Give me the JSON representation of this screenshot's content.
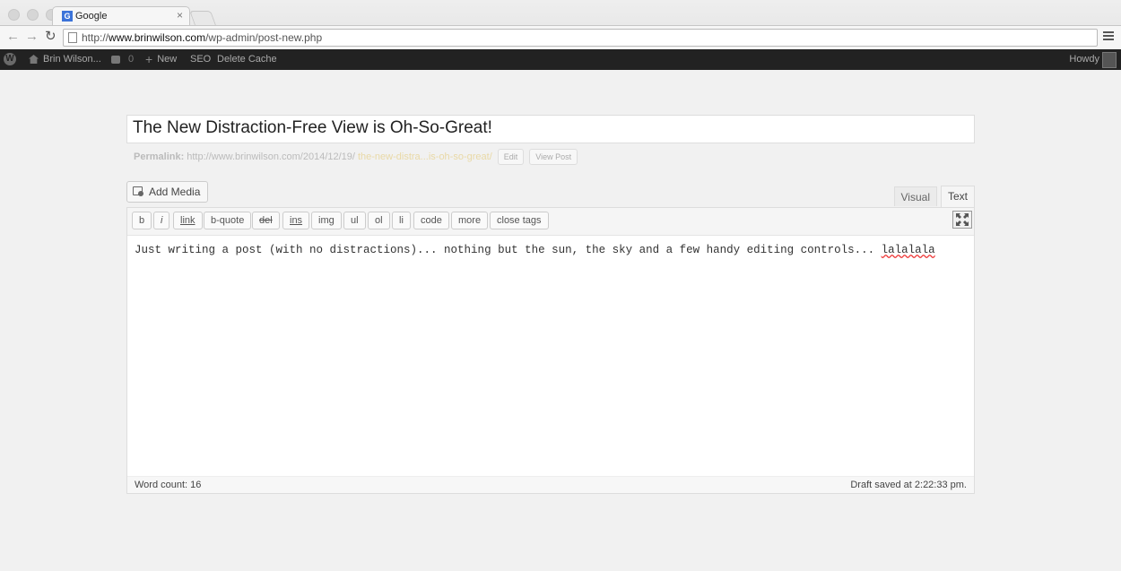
{
  "browser": {
    "tab_title": "Google",
    "tab_favicon": "G",
    "url_prefix": "http://",
    "url_domain": "www.brinwilson.com",
    "url_path": "/wp-admin/post-new.php"
  },
  "adminbar": {
    "site": "Brin Wilson...",
    "comments_count": "0",
    "new_label": "New",
    "seo_label": "SEO",
    "cache_label": "Delete Cache",
    "howdy": "Howdy"
  },
  "post": {
    "title": "The New Distraction-Free View is Oh-So-Great!",
    "permalink_label": "Permalink:",
    "permalink_base": "http://www.brinwilson.com/2014/12/19/",
    "permalink_slug": "the-new-distra...is-oh-so-great/",
    "edit_label": "Edit",
    "view_label": "View Post"
  },
  "editor": {
    "add_media": "Add Media",
    "tab_visual": "Visual",
    "tab_text": "Text",
    "quicktags": [
      "b",
      "i",
      "link",
      "b-quote",
      "del",
      "ins",
      "img",
      "ul",
      "ol",
      "li",
      "code",
      "more",
      "close tags"
    ],
    "content_text": "Just writing a post (with no distractions)... nothing but the sun, the sky and a few handy editing controls... ",
    "content_misspelled": "lalalala",
    "word_count": "Word count: 16",
    "draft_saved": "Draft saved at 2:22:33 pm."
  }
}
